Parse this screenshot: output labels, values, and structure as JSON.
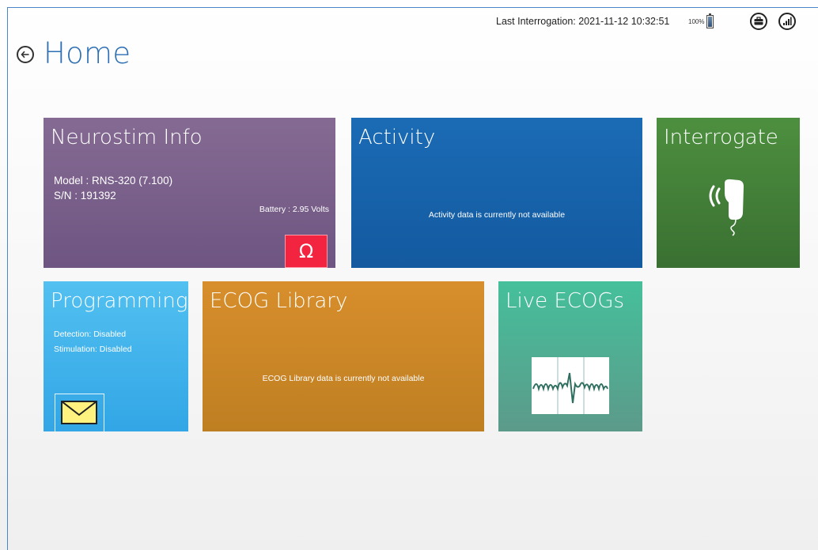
{
  "header": {
    "last_interrogation": "Last Interrogation: 2021-11-12 10:32:51",
    "battery_percent": "100%"
  },
  "page": {
    "title": "Home"
  },
  "tiles": {
    "neurostim": {
      "title": "Neurostim Info",
      "model": "Model : RNS-320 (7.100)",
      "serial": "S/N : 191392",
      "battery": "Battery : 2.95 Volts",
      "omega_symbol": "Ω"
    },
    "activity": {
      "title": "Activity",
      "message": "Activity data is currently not available"
    },
    "interrogate": {
      "title": "Interrogate"
    },
    "programming": {
      "title": "Programming",
      "detection": "Detection: Disabled",
      "stimulation": "Stimulation: Disabled"
    },
    "ecog_library": {
      "title": "ECOG Library",
      "message": "ECOG Library data is currently not available"
    },
    "live_ecogs": {
      "title": "Live ECOGs"
    }
  },
  "colors": {
    "neurostim": "#7a6190",
    "activity": "#1763ab",
    "interrogate": "#44803a",
    "programming": "#42b3eb",
    "ecog_library": "#cc8628",
    "live_ecogs": "#4fae93",
    "omega_button": "#f2243f",
    "title_blue": "#2d6fb3"
  },
  "icons": [
    "battery-icon",
    "briefcase-icon",
    "signal-icon",
    "back-arrow-icon",
    "omega-icon",
    "telemetry-wand-icon",
    "envelope-icon",
    "ecog-waveform-icon"
  ]
}
